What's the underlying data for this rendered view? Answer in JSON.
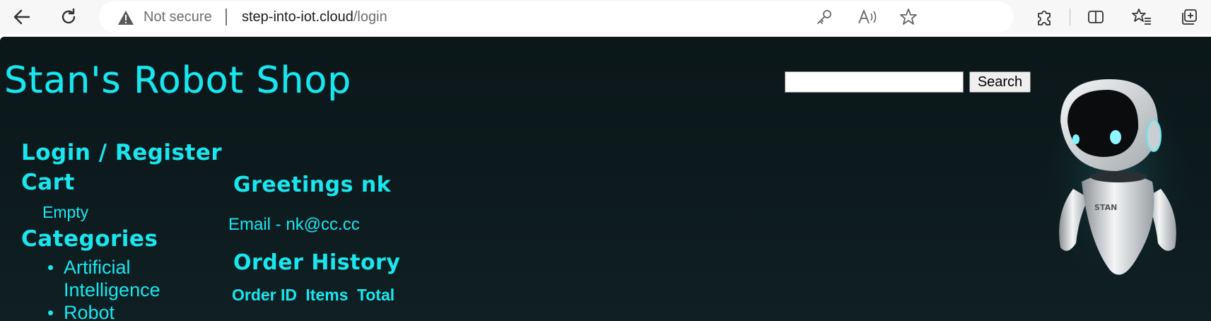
{
  "browser": {
    "security_label": "Not secure",
    "url_host": "step-into-iot.cloud",
    "url_path": "/login",
    "icons": [
      "back-icon",
      "refresh-icon",
      "warning-icon",
      "key-icon",
      "read-aloud-icon",
      "favorite-star-icon",
      "extensions-icon",
      "split-screen-icon",
      "favorites-icon",
      "collections-icon"
    ]
  },
  "site": {
    "title": "Stan's Robot Shop",
    "search_button": "Search",
    "search_value": ""
  },
  "sidebar": {
    "login_register": "Login / Register",
    "cart": "Cart",
    "cart_status": "Empty",
    "categories": "Categories",
    "category_items": [
      "Artificial Intelligence",
      "Robot"
    ]
  },
  "main": {
    "greeting": "Greetings nk",
    "email_line": "Email - nk@cc.cc",
    "order_history": "Order History",
    "order_columns": [
      "Order ID",
      "Items",
      "Total"
    ]
  },
  "colors": {
    "neon": "#19e6ef",
    "page_bg": "#0d1b1e",
    "chrome_bg": "#f7f7f7"
  }
}
